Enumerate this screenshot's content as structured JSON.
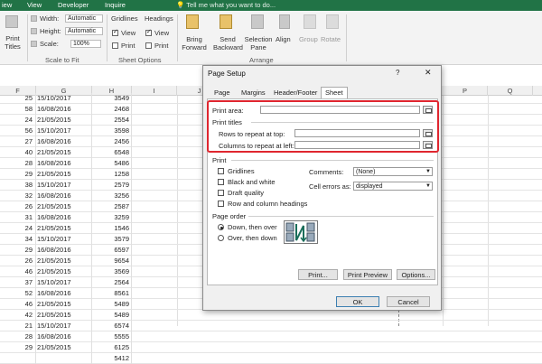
{
  "menubar": {
    "items": [
      "iew",
      "View",
      "Developer",
      "Inquire"
    ],
    "tell_me": "Tell me what you want to do..."
  },
  "ribbon": {
    "print_titles": "Print Titles",
    "scale_to_fit": {
      "width_label": "Width:",
      "width_value": "Automatic",
      "height_label": "Height:",
      "height_value": "Automatic",
      "scale_label": "Scale:",
      "scale_value": "100%",
      "group_label": "Scale to Fit"
    },
    "sheet_options": {
      "gridlines": "Gridlines",
      "headings": "Headings",
      "view": "View",
      "print": "Print",
      "group_label": "Sheet Options"
    },
    "arrange": {
      "bring_forward": "Bring Forward",
      "send_backward": "Send Backward",
      "selection_pane": "Selection Pane",
      "align": "Align",
      "group": "Group",
      "rotate": "Rotate",
      "group_label": "Arrange"
    }
  },
  "sheet": {
    "columns": [
      "F",
      "G",
      "H",
      "I",
      "J",
      "P",
      "Q"
    ],
    "rows": [
      [
        "25",
        "15/10/2017",
        "3549"
      ],
      [
        "58",
        "16/08/2016",
        "2468"
      ],
      [
        "24",
        "21/05/2015",
        "2554"
      ],
      [
        "56",
        "15/10/2017",
        "3598"
      ],
      [
        "27",
        "16/08/2016",
        "2456"
      ],
      [
        "40",
        "21/05/2015",
        "6548"
      ],
      [
        "28",
        "16/08/2016",
        "5486"
      ],
      [
        "29",
        "21/05/2015",
        "1258"
      ],
      [
        "38",
        "15/10/2017",
        "2579"
      ],
      [
        "32",
        "16/08/2016",
        "3256"
      ],
      [
        "26",
        "21/05/2015",
        "2587"
      ],
      [
        "31",
        "16/08/2016",
        "3259"
      ],
      [
        "24",
        "21/05/2015",
        "1546"
      ],
      [
        "34",
        "15/10/2017",
        "3579"
      ],
      [
        "29",
        "16/08/2016",
        "6597"
      ],
      [
        "26",
        "21/05/2015",
        "9654"
      ],
      [
        "46",
        "21/05/2015",
        "3569"
      ],
      [
        "37",
        "15/10/2017",
        "2564"
      ],
      [
        "52",
        "16/08/2016",
        "8561"
      ],
      [
        "46",
        "21/05/2015",
        "5489"
      ],
      [
        "42",
        "21/05/2015",
        "5489"
      ],
      [
        "21",
        "15/10/2017",
        "6574"
      ],
      [
        "28",
        "16/08/2016",
        "5555"
      ],
      [
        "29",
        "21/05/2015",
        "6125"
      ],
      [
        "",
        "",
        "5412"
      ]
    ]
  },
  "dialog": {
    "title": "Page Setup",
    "help": "?",
    "close": "✕",
    "tabs": [
      "Page",
      "Margins",
      "Header/Footer",
      "Sheet"
    ],
    "print_area_label": "Print area:",
    "print_titles_label": "Print titles",
    "rows_repeat_label": "Rows to repeat at top:",
    "cols_repeat_label": "Columns to repeat at left:",
    "print_section_label": "Print",
    "gridlines": "Gridlines",
    "black_white": "Black and white",
    "draft_quality": "Draft quality",
    "row_col_headings": "Row and column headings",
    "comments_label": "Comments:",
    "comments_value": "(None)",
    "cell_errors_label": "Cell errors as:",
    "cell_errors_value": "displayed",
    "page_order_label": "Page order",
    "down_then_over": "Down, then over",
    "over_then_down": "Over, then down",
    "print_button": "Print...",
    "print_preview_button": "Print Preview",
    "options_button": "Options...",
    "ok_button": "OK",
    "cancel_button": "Cancel"
  },
  "colors": {
    "excel_green": "#217346",
    "highlight_red": "#e0262f"
  }
}
